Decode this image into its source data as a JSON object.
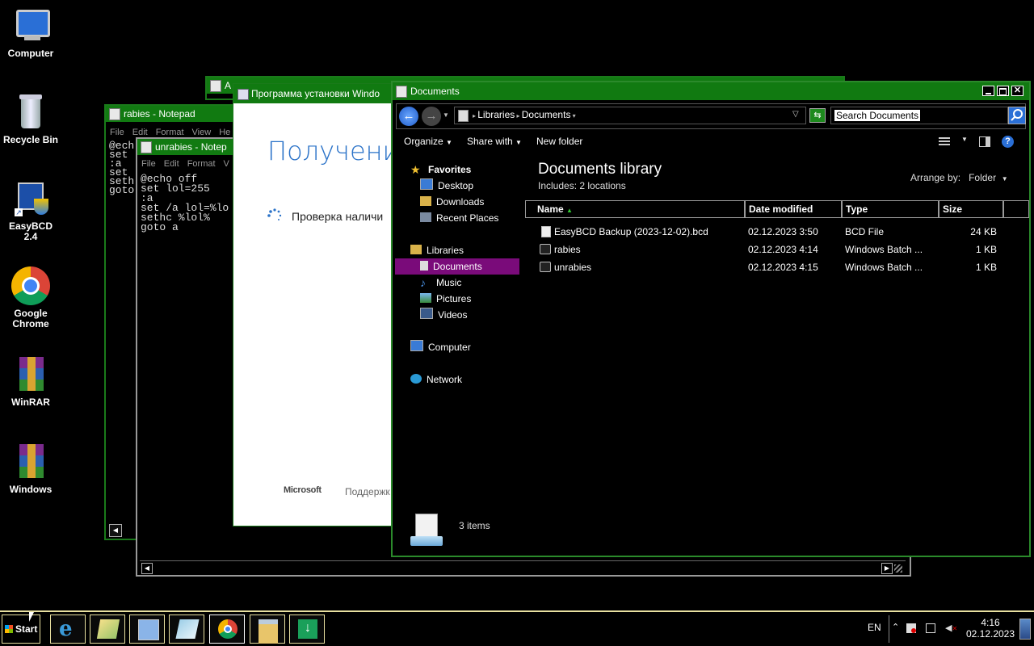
{
  "desktop": {
    "icons": [
      {
        "label": "Computer"
      },
      {
        "label": "Recycle Bin"
      },
      {
        "label": "EasyBCD\n2.4"
      },
      {
        "label": "Google\nChrome"
      },
      {
        "label": "WinRAR"
      },
      {
        "label": "Windows"
      }
    ]
  },
  "notepad_rabies": {
    "title": "rabies - Notepad",
    "menu": [
      "File",
      "Edit",
      "Format",
      "View",
      "He"
    ],
    "lines": [
      "@ech",
      "set",
      ":a",
      "set",
      "seth",
      "goto"
    ]
  },
  "notepad_unrabies": {
    "title": "unrabies - Notep",
    "menu": [
      "File",
      "Edit",
      "Format",
      "V"
    ],
    "text": "@echo off\nset lol=255\n:a\nset /a lol=%lo\nsethc %lol%\ngoto a"
  },
  "installer": {
    "back_title": "A",
    "title": "Программа установки Windo",
    "heading": "Получение",
    "status": "Проверка наличи",
    "footer_brand": "Microsoft",
    "footer_link": "Поддержк"
  },
  "explorer": {
    "title": "Documents",
    "breadcrumb": [
      "Libraries",
      "Documents"
    ],
    "search_placeholder": "Search Documents",
    "toolbar": {
      "organize": "Organize",
      "share": "Share with",
      "new_folder": "New folder"
    },
    "library_title": "Documents library",
    "library_includes": "Includes:  2 locations",
    "arrange_label": "Arrange by:",
    "arrange_value": "Folder",
    "nav": {
      "favorites": "Favorites",
      "desktop": "Desktop",
      "downloads": "Downloads",
      "recent": "Recent Places",
      "libraries": "Libraries",
      "documents": "Documents",
      "music": "Music",
      "pictures": "Pictures",
      "videos": "Videos",
      "computer": "Computer",
      "network": "Network"
    },
    "columns": {
      "name": "Name",
      "date": "Date modified",
      "type": "Type",
      "size": "Size"
    },
    "files": [
      {
        "name": "EasyBCD Backup (2023-12-02).bcd",
        "date": "02.12.2023 3:50",
        "type": "BCD File",
        "size": "24 KB"
      },
      {
        "name": "rabies",
        "date": "02.12.2023 4:14",
        "type": "Windows Batch ...",
        "size": "1 KB"
      },
      {
        "name": "unrabies",
        "date": "02.12.2023 4:15",
        "type": "Windows Batch ...",
        "size": "1 KB"
      }
    ],
    "status_count": "3 items"
  },
  "taskbar": {
    "start_label": "Start",
    "lang": "EN",
    "time": "4:16",
    "date": "02.12.2023"
  },
  "colors": {
    "accent": "#117a11",
    "selection": "#7a0b7a",
    "taskbar_border": "#e8e0a0"
  }
}
